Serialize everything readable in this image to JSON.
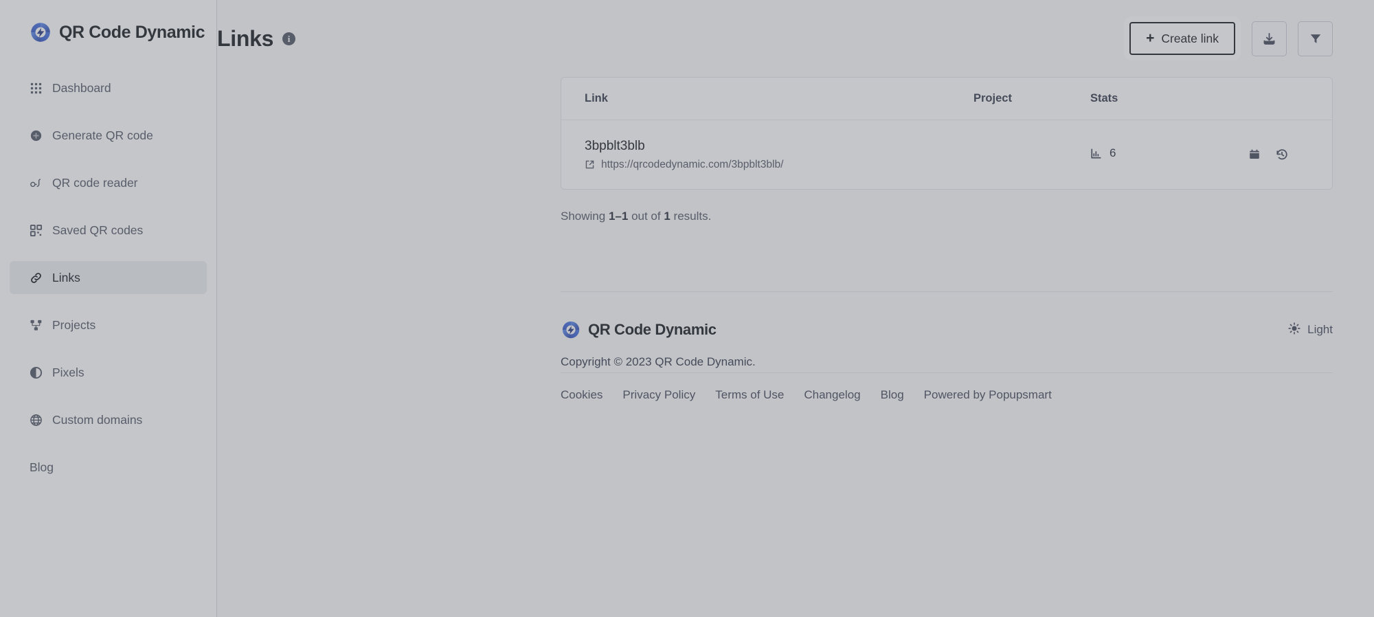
{
  "brand": {
    "name": "QR Code Dynamic",
    "logo_icon": "qr-code-dynamic-logo"
  },
  "sidebar": {
    "items": [
      {
        "id": "dashboard",
        "label": "Dashboard",
        "icon": "grid-icon",
        "active": false
      },
      {
        "id": "generate-qr",
        "label": "Generate QR code",
        "icon": "plus-circle-icon",
        "active": false
      },
      {
        "id": "qr-reader",
        "label": "QR code reader",
        "icon": "glasses-icon",
        "active": false
      },
      {
        "id": "saved-qr",
        "label": "Saved QR codes",
        "icon": "qr-code-icon",
        "active": false
      },
      {
        "id": "links",
        "label": "Links",
        "icon": "link-icon",
        "active": true
      },
      {
        "id": "projects",
        "label": "Projects",
        "icon": "sitemap-icon",
        "active": false
      },
      {
        "id": "pixels",
        "label": "Pixels",
        "icon": "contrast-icon",
        "active": false
      },
      {
        "id": "custom-domains",
        "label": "Custom domains",
        "icon": "globe-icon",
        "active": false
      },
      {
        "id": "blog",
        "label": "Blog",
        "icon": "none",
        "active": false
      }
    ]
  },
  "header": {
    "title": "Links",
    "info_icon": "info-icon",
    "create_label": "Create link",
    "create_plus": "+",
    "export_icon": "download-icon",
    "filter_icon": "filter-icon"
  },
  "table": {
    "columns": {
      "link": "Link",
      "project": "Project",
      "stats": "Stats"
    },
    "rows": [
      {
        "slug": "3bpblt3blb",
        "url": "https://qrcodedynamic.com/3bpblt3blb/",
        "external_icon": "external-link-icon",
        "project": "",
        "stats_icon": "bar-chart-icon",
        "stats_count": "6",
        "calendar_icon": "calendar-icon",
        "history_icon": "history-icon",
        "copy_icon": "copy-icon",
        "more_icon": "more-vertical-icon"
      }
    ]
  },
  "results": {
    "prefix": "Showing",
    "range": "1–1",
    "middle": "out of",
    "total": "1",
    "suffix": "results."
  },
  "footer": {
    "brand_name": "QR Code Dynamic",
    "copyright": "Copyright © 2023 QR Code Dynamic.",
    "theme": {
      "icon": "sun-icon",
      "label": "Light"
    },
    "links": [
      {
        "id": "cookies",
        "label": "Cookies"
      },
      {
        "id": "privacy",
        "label": "Privacy Policy"
      },
      {
        "id": "terms",
        "label": "Terms of Use"
      },
      {
        "id": "changelog",
        "label": "Changelog"
      },
      {
        "id": "blog",
        "label": "Blog"
      },
      {
        "id": "powered",
        "label": "Powered by Popupsmart"
      }
    ]
  },
  "colors": {
    "brand_blue": "#2f5bd0",
    "text_dark": "#0d1117",
    "text_muted": "#4a5160",
    "active_bg": "#eceef1",
    "border": "#e2e4e8",
    "page_bg": "#fafafa",
    "scrim": "rgba(110,113,122,0.40)"
  }
}
